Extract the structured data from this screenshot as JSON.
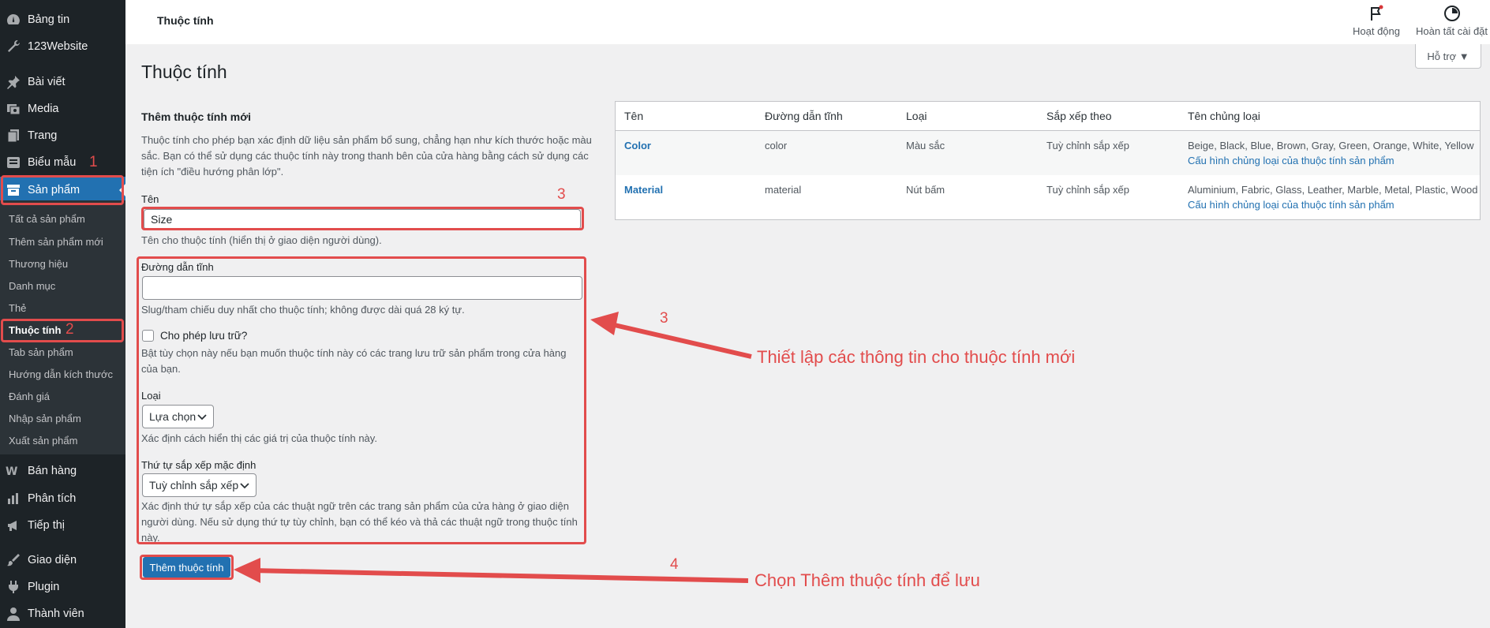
{
  "sidebar": {
    "items": [
      {
        "label": "Bảng tin",
        "icon": "dashboard-icon"
      },
      {
        "label": "123Website",
        "icon": "wrench-icon"
      },
      {
        "label": "Bài viết",
        "icon": "pin-icon"
      },
      {
        "label": "Media",
        "icon": "media-icon"
      },
      {
        "label": "Trang",
        "icon": "page-icon"
      },
      {
        "label": "Biểu mẫu",
        "icon": "form-icon"
      },
      {
        "label": "Sản phẩm",
        "icon": "archive-icon"
      },
      {
        "label": "Bán hàng",
        "icon": "woo-icon"
      },
      {
        "label": "Phân tích",
        "icon": "chart-icon"
      },
      {
        "label": "Tiếp thị",
        "icon": "megaphone-icon"
      },
      {
        "label": "Giao diện",
        "icon": "brush-icon"
      },
      {
        "label": "Plugin",
        "icon": "plugin-icon"
      },
      {
        "label": "Thành viên",
        "icon": "user-icon"
      }
    ],
    "submenu": [
      "Tất cả sản phẩm",
      "Thêm sản phẩm mới",
      "Thương hiệu",
      "Danh mục",
      "Thẻ",
      "Thuộc tính",
      "Tab sản phẩm",
      "Hướng dẫn kích thước",
      "Đánh giá",
      "Nhập sản phẩm",
      "Xuất sản phẩm"
    ]
  },
  "annotations": {
    "step1": "1",
    "step2": "2",
    "step3a": "3",
    "step3b": "3",
    "step4": "4",
    "note_fields": "Thiết lập các thông tin cho thuộc tính mới",
    "note_save": "Chọn Thêm thuộc tính để lưu",
    "color": "#e24c4c"
  },
  "topbar": {
    "title": "Thuộc tính",
    "activity": "Hoạt động",
    "setup": "Hoàn tất cài đặt",
    "help": "Hỗ trợ ▼"
  },
  "page": {
    "heading": "Thuộc tính"
  },
  "form": {
    "title": "Thêm thuộc tính mới",
    "intro": "Thuộc tính cho phép bạn xác định dữ liệu sản phẩm bổ sung, chẳng hạn như kích thước hoặc màu sắc. Bạn có thể sử dụng các thuộc tính này trong thanh bên của cửa hàng bằng cách sử dụng các tiện ích \"điều hướng phân lớp\".",
    "name_label": "Tên",
    "name_value": "Size",
    "name_help": "Tên cho thuộc tính (hiển thị ở giao diện người dùng).",
    "slug_label": "Đường dẫn tĩnh",
    "slug_value": "",
    "slug_help": "Slug/tham chiếu duy nhất cho thuộc tính; không được dài quá 28 ký tự.",
    "archive_label": "Cho phép lưu trữ?",
    "archive_help": "Bật tùy chọn này nếu bạn muốn thuộc tính này có các trang lưu trữ sản phẩm trong cửa hàng của bạn.",
    "type_label": "Loại",
    "type_value": "Lựa chọn",
    "type_help": "Xác định cách hiển thị các giá trị của thuộc tính này.",
    "order_label": "Thứ tự sắp xếp mặc định",
    "order_value": "Tuỳ chỉnh sắp xếp",
    "order_help": "Xác định thứ tự sắp xếp của các thuật ngữ trên các trang sản phẩm của cửa hàng ở giao diện người dùng. Nếu sử dụng thứ tự tùy chỉnh, bạn có thể kéo và thả các thuật ngữ trong thuộc tính này.",
    "submit": "Thêm thuộc tính"
  },
  "table": {
    "columns": [
      "Tên",
      "Đường dẫn tĩnh",
      "Loại",
      "Sắp xếp theo",
      "Tên chủng loại"
    ],
    "rows": [
      {
        "name": "Color",
        "slug": "color",
        "type": "Màu sắc",
        "order": "Tuỳ chỉnh sắp xếp",
        "terms": "Beige, Black, Blue, Brown, Gray, Green, Orange, White, Yellow",
        "configure": "Cấu hình chủng loại của thuộc tính sản phẩm"
      },
      {
        "name": "Material",
        "slug": "material",
        "type": "Nút bấm",
        "order": "Tuỳ chỉnh sắp xếp",
        "terms": "Aluminium, Fabric, Glass, Leather, Marble, Metal, Plastic, Wood",
        "configure": "Cấu hình chủng loại của thuộc tính sản phẩm"
      }
    ]
  }
}
